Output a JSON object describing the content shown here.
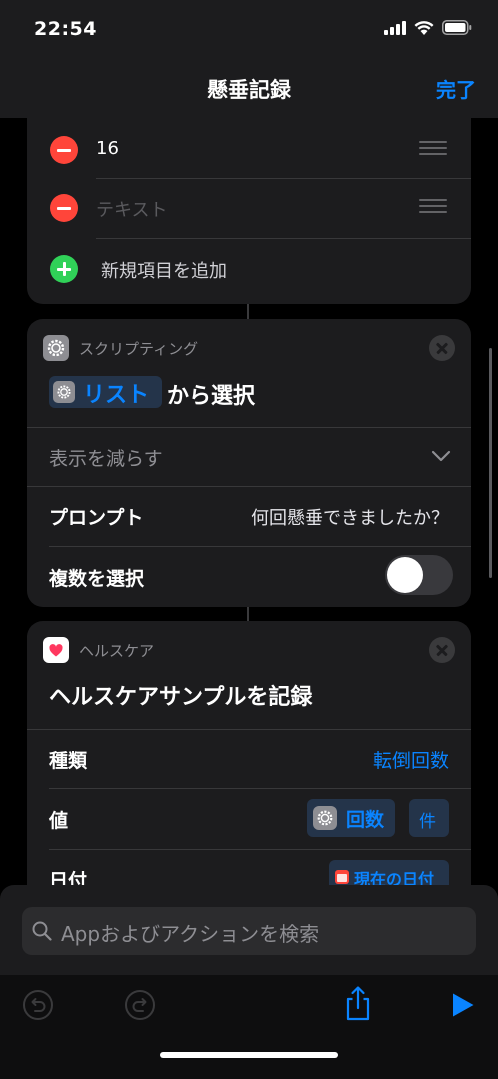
{
  "status_bar": {
    "time": "22:54"
  },
  "nav": {
    "title": "懸垂記録",
    "done_label": "完了"
  },
  "list_card": {
    "items": [
      {
        "text": "16"
      },
      {
        "text": "テキスト"
      }
    ],
    "add_label": "新規項目を追加"
  },
  "choose_card": {
    "category": "スクリプティング",
    "title_chip": "リスト",
    "title_rest": "から選択",
    "show_less": "表示を減らす",
    "prompt_label": "プロンプト",
    "prompt_value": "何回懸垂できましたか？",
    "multiple_label": "複数を選択",
    "multiple_enabled": false
  },
  "health_card": {
    "category": "ヘルスケア",
    "title": "ヘルスケアサンプルを記録",
    "type_label": "種類",
    "type_value": "転倒回数",
    "value_label": "値",
    "value_chip": "回数",
    "value_unit": "件",
    "date_label": "日付",
    "date_value": "現在の日付"
  },
  "search": {
    "placeholder": "Appおよびアクションを検索"
  },
  "colors": {
    "accent": "#0a84ff",
    "minus": "#ff453a",
    "plus": "#30d158"
  }
}
